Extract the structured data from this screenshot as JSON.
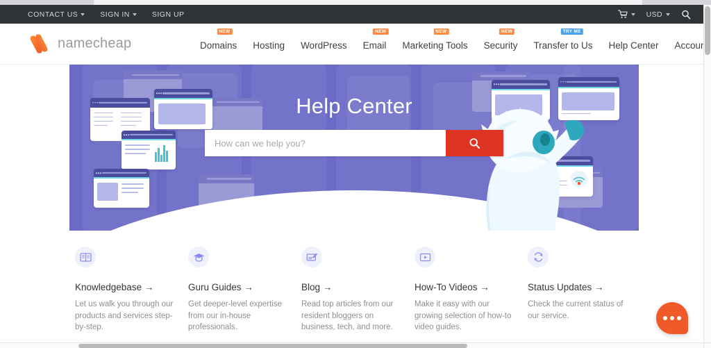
{
  "utility_bar": {
    "items": [
      {
        "label": "CONTACT US",
        "has_caret": true
      },
      {
        "label": "SIGN IN",
        "has_caret": true
      },
      {
        "label": "SIGN UP",
        "has_caret": false
      }
    ],
    "cart_icon": "shopping-cart-icon",
    "currency": "USD",
    "search_icon": "search-icon"
  },
  "brand": {
    "logo_icon": "namecheap-logo-icon",
    "name": "namecheap"
  },
  "nav": {
    "items": [
      {
        "label": "Domains",
        "badge": "NEW",
        "badge_style": "orange"
      },
      {
        "label": "Hosting",
        "badge": "",
        "badge_style": ""
      },
      {
        "label": "WordPress",
        "badge": "",
        "badge_style": ""
      },
      {
        "label": "Email",
        "badge": "NEW",
        "badge_style": "orange"
      },
      {
        "label": "Marketing Tools",
        "badge": "NEW",
        "badge_style": "orange"
      },
      {
        "label": "Security",
        "badge": "NEW",
        "badge_style": "orange"
      },
      {
        "label": "Transfer to Us",
        "badge": "TRY ME",
        "badge_style": "blue"
      },
      {
        "label": "Help Center",
        "badge": "",
        "badge_style": ""
      },
      {
        "label": "Account",
        "badge": "",
        "badge_style": ""
      }
    ]
  },
  "hero": {
    "title": "Help Center",
    "search_placeholder": "How can we help you?",
    "search_value": "",
    "search_button_icon": "search-icon",
    "background_color": "#6b6bc7",
    "search_button_color": "#dd3522",
    "illustration": "yeti-with-browser-windows"
  },
  "cards": [
    {
      "icon": "open-book-icon",
      "title": "Knowledgebase →",
      "desc": "Let us walk you through our products and services step-by-step."
    },
    {
      "icon": "graduation-cap-icon",
      "title": "Guru Guides →",
      "desc": "Get deeper-level expertise from our in-house professionals."
    },
    {
      "icon": "pencil-edit-icon",
      "title": "Blog →",
      "desc": "Read top articles from our resident bloggers on business, tech, and more."
    },
    {
      "icon": "play-video-icon",
      "title": "How-To Videos →",
      "desc": "Make it easy with our growing selection of how-to video guides."
    },
    {
      "icon": "refresh-sync-icon",
      "title": "Status Updates →",
      "desc": "Check the current status of our service."
    }
  ],
  "chat_widget": {
    "icon": "chat-bubble-icon",
    "color": "#f05a28"
  }
}
